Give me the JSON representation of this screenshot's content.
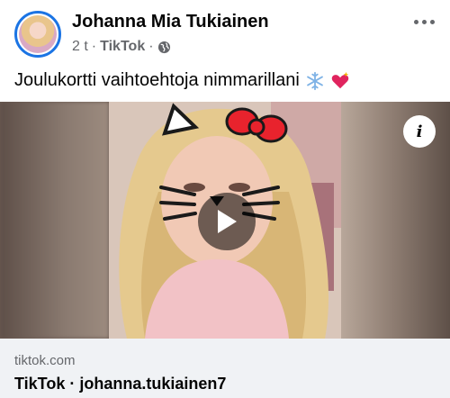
{
  "post": {
    "author": "Johanna Mia Tukiainen",
    "time": "2 t",
    "separator": "·",
    "source": "TikTok",
    "separator2": "·",
    "caption": "Joulukortti vaihtoehtoja nimmarillani",
    "caption_emojis": [
      "snowflake-emoji",
      "sparkling-heart-emoji"
    ]
  },
  "link": {
    "domain": "tiktok.com",
    "title": "TikTok · johanna.tukiainen7"
  },
  "icons": {
    "more": "more-options-icon",
    "privacy": "globe-icon",
    "info": "info-icon",
    "play": "play-icon"
  },
  "colors": {
    "accent": "#1b74e4",
    "secondary_text": "#65676b",
    "card_background": "#f0f2f5"
  }
}
